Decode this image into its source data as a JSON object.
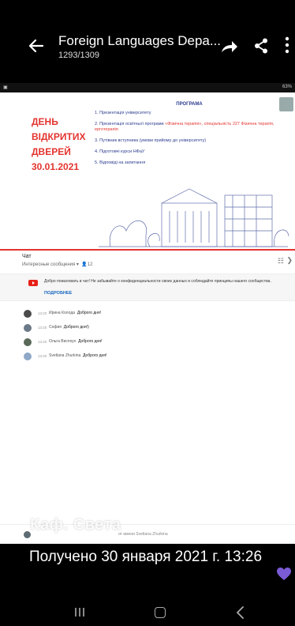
{
  "header": {
    "title": "Foreign Languages Depa...",
    "counter": "1293/1309"
  },
  "statusbar": {
    "right": "63%"
  },
  "slide": {
    "left_lines": [
      "ДЕНЬ",
      "ВІДКРИТИХ",
      "ДВЕРЕЙ",
      "30.01.2021"
    ],
    "program_title": "ПРОГРАМА",
    "items": [
      {
        "num": "1.",
        "text": "Презентація університету"
      },
      {
        "num": "2.",
        "text": "Презентація освітньої програми",
        "highlight": "«Фізична терапія», спеціальність 227 Фізична терапія, ерготерапія"
      },
      {
        "num": "3.",
        "text": "Путівник вступника (умови прийому до університету)"
      },
      {
        "num": "4.",
        "text": "Підготовчі курси НФаУ"
      },
      {
        "num": "5.",
        "text": "Відповіді на запитання"
      }
    ]
  },
  "chat": {
    "title": "Чат",
    "subtitle": "Интересные сообщения",
    "viewers": "12",
    "welcome": "Добро пожаловать в чат! Не забывайте о конфиденциальности своих данных и соблюдайте принципы нашего сообщества.",
    "more_link": "ПОДРОБНЕЕ",
    "messages": [
      {
        "time": "13:20",
        "author": "Ирина Колода",
        "text": "Доброго дня!",
        "avatar_color": "#4a4a4a"
      },
      {
        "time": "13:20",
        "author": "София",
        "text": "Доброго дня!)",
        "avatar_color": "#6b7a88"
      },
      {
        "time": "13:20",
        "author": "Ольга Виспоух",
        "text": "Доброго дня!",
        "avatar_color": "#5a6a5a"
      },
      {
        "time": "13:20",
        "author": "Svetlana Zhurkina",
        "text": "Доброго дня!",
        "avatar_color": "#8fa8c8"
      }
    ],
    "input_placeholder": "от имени Svetlana Zhurkina"
  },
  "watermark": "Каф. Света",
  "received": "Получено 30 января 2021 г. 13:26",
  "colors": {
    "accent_red": "#e3342f",
    "heart": "#7b5bd6",
    "link_blue": "#1565c0"
  }
}
